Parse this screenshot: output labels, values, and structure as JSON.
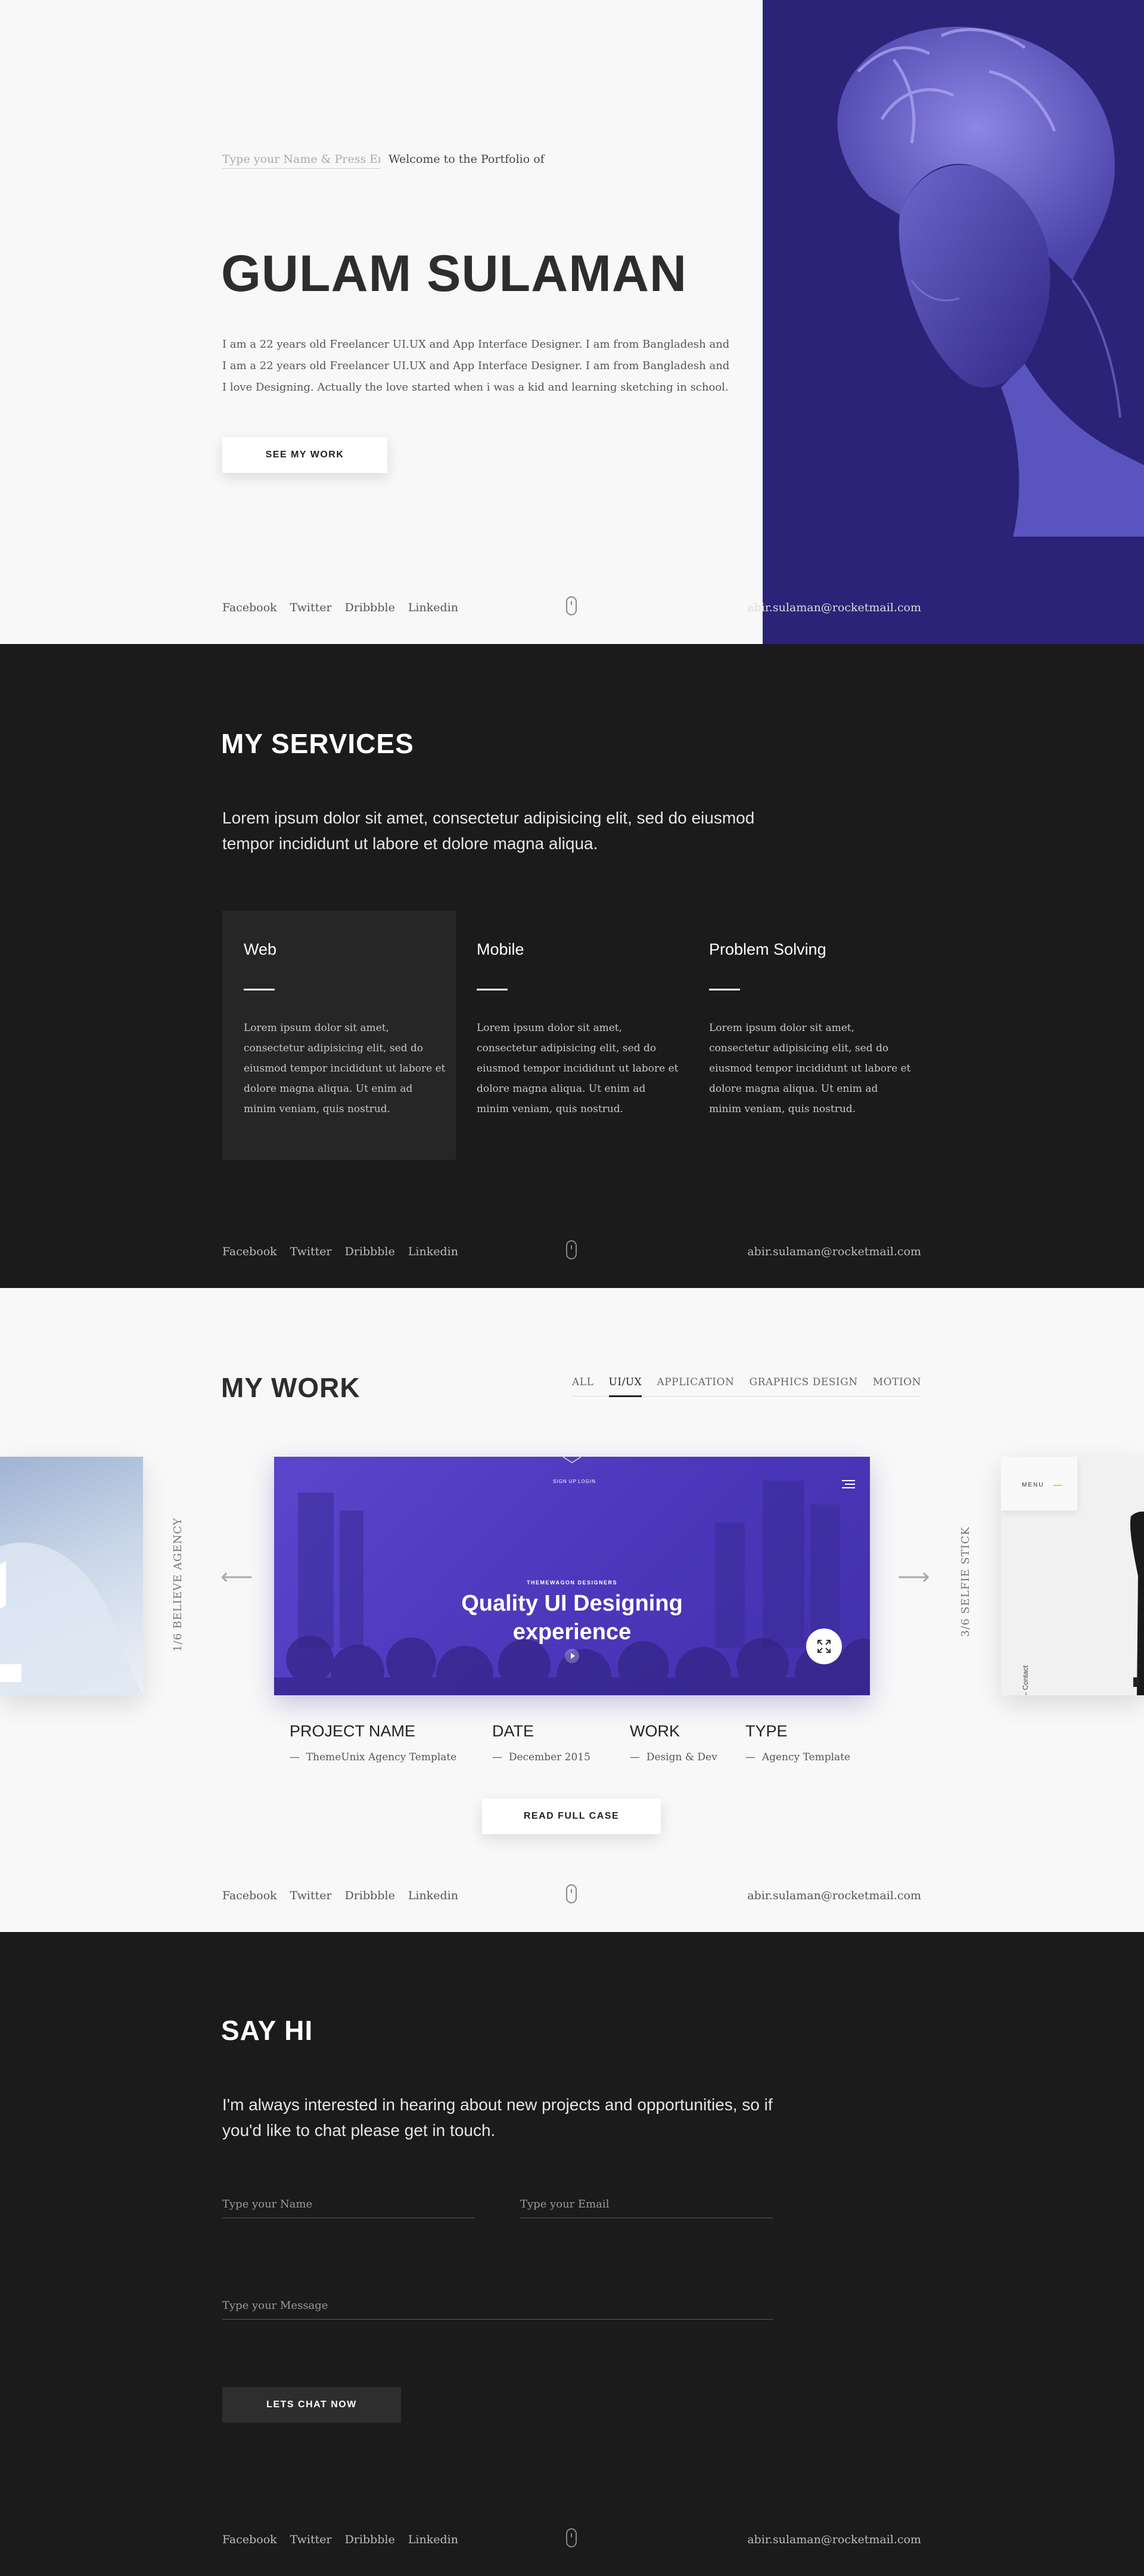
{
  "footer": {
    "social": [
      "Facebook",
      "Twitter",
      "Dribbble",
      "Linkedin"
    ],
    "email": "abir.sulaman@rocketmail.com"
  },
  "hero": {
    "name_placeholder": "Type your Name & Press Enter",
    "welcome": "Welcome to the Portfolio of",
    "title": "GULAM SULAMAN",
    "bio": "I am a 22 years old Freelancer UI.UX and App Interface Designer. I am from Bangladesh and I am a 22 years old Freelancer UI.UX and App Interface Designer. I am from Bangladesh and I love Designing. Actually the love started when i was a kid and learning sketching in school.",
    "cta": "SEE MY WORK",
    "accent_color": "#2a2377"
  },
  "services": {
    "title": "MY SERVICES",
    "lead": "Lorem ipsum dolor sit amet, consectetur adipisicing elit, sed do eiusmod tempor incididunt ut labore et dolore magna aliqua.",
    "cards": [
      {
        "title": "Web",
        "text": "Lorem ipsum dolor sit amet, consectetur adipisicing elit, sed do eiusmod tempor incididunt ut labore et dolore magna aliqua. Ut enim ad minim veniam, quis nostrud."
      },
      {
        "title": "Mobile",
        "text": "Lorem ipsum dolor sit amet, consectetur adipisicing elit, sed do eiusmod tempor incididunt ut labore et dolore magna aliqua. Ut enim ad minim veniam, quis nostrud."
      },
      {
        "title": "Problem Solving",
        "text": "Lorem ipsum dolor sit amet, consectetur adipisicing elit, sed do eiusmod tempor incididunt ut labore et dolore magna aliqua. Ut enim ad minim veniam, quis nostrud."
      }
    ]
  },
  "work": {
    "title": "MY WORK",
    "filters": [
      "ALL",
      "UI/UX",
      "APPLICATION",
      "GRAPHICS DESIGN",
      "MOTION"
    ],
    "active_filter": "UI/UX",
    "prev_label": "1/6 BELIEVE AGENCY",
    "next_label": "3/6 SELFIE STICK",
    "project": {
      "brand": "THEMEWAGON DESIGNERS",
      "nav_left": "SIGN UP",
      "nav_right": "LOGIN",
      "headline_1": "Quality UI Designing",
      "headline_2": "experience"
    },
    "side_right": {
      "menu": "MENU",
      "vertical_text": "your offer — Store — Contact"
    },
    "info": [
      {
        "label": "PROJECT NAME",
        "value": "ThemeUnix Agency Template"
      },
      {
        "label": "DATE",
        "value": "December 2015"
      },
      {
        "label": "WORK",
        "value": "Design & Dev"
      },
      {
        "label": "TYPE",
        "value": "Agency Template"
      }
    ],
    "cta": "READ FULL CASE",
    "accent_color": "#4f3bc0"
  },
  "contact": {
    "title": "SAY HI",
    "lead": "I'm always interested in hearing about new projects and opportunities, so if you'd like to chat please get in touch.",
    "name_placeholder": "Type your Name",
    "email_placeholder": "Type your Email",
    "message_placeholder": "Type your Message",
    "cta": "LETS CHAT NOW"
  }
}
